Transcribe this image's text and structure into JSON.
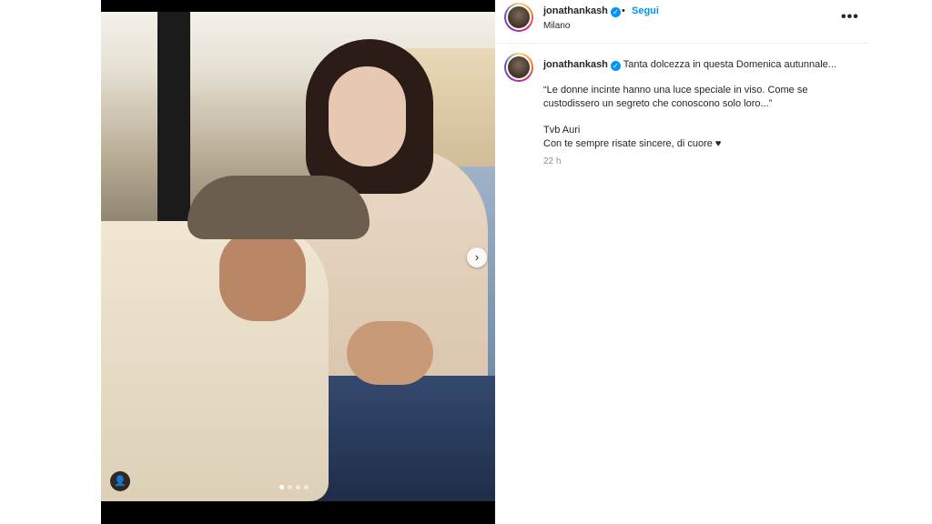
{
  "post": {
    "username": "jonathankash",
    "follow_label": "Segui",
    "separator": "•",
    "location": "Milano",
    "more_icon": "•••",
    "caption_intro": "Tanta dolcezza in questa Domenica autunnale...",
    "quote_line1": "“Le donne incinte hanno una luce speciale in viso. Come se",
    "quote_line2": "custodissero un segreto che conoscono solo loro...”",
    "line_tvb": "Tvb Auri",
    "line_final": "Con te sempre risate sincere, di cuore ♥",
    "time_ago": "22 h"
  },
  "media": {
    "carousel_next_icon": "›",
    "tag_icon": "👤",
    "dots_count": 4,
    "active_dot": 0
  },
  "colors": {
    "accent": "#0095f6",
    "text": "#262626",
    "muted": "#8e8e8e"
  }
}
